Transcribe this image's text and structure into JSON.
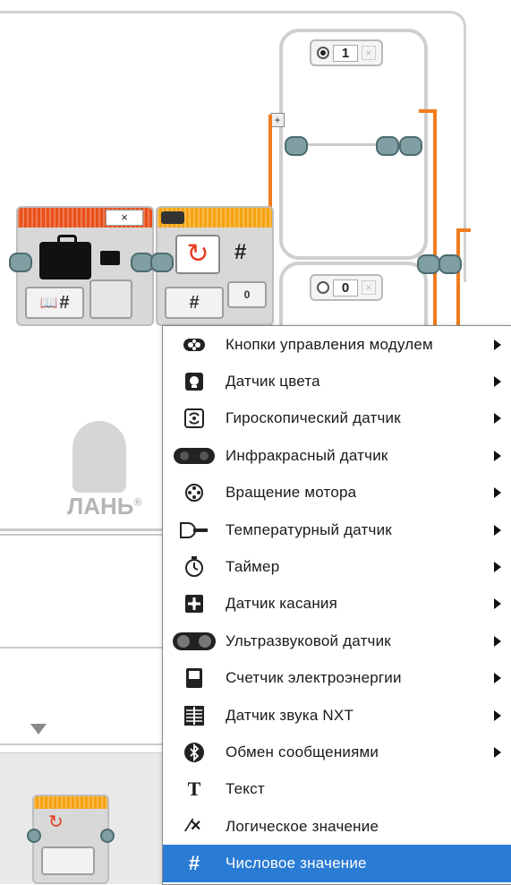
{
  "canvas": {
    "case_top_value": "1",
    "case_bottom_value": "0",
    "case_remove_glyph": "×",
    "add_case_glyph": "+",
    "block1_close_glyph": "×",
    "param_hash_label": "#",
    "book_hash_label": "#",
    "switch_output_hash": "#",
    "switch_value": "0"
  },
  "watermark": {
    "text": "ЛАНЬ",
    "mark": "®"
  },
  "menu": {
    "items": [
      {
        "label": "Кнопки управления модулем",
        "icon": "brick-buttons-icon",
        "has_submenu": true
      },
      {
        "label": "Датчик цвета",
        "icon": "color-sensor-icon",
        "has_submenu": true
      },
      {
        "label": "Гироскопический датчик",
        "icon": "gyro-sensor-icon",
        "has_submenu": true
      },
      {
        "label": "Инфракрасный датчик",
        "icon": "infrared-sensor-icon",
        "has_submenu": true
      },
      {
        "label": "Вращение мотора",
        "icon": "motor-rotation-icon",
        "has_submenu": true
      },
      {
        "label": "Температурный датчик",
        "icon": "temperature-sensor-icon",
        "has_submenu": true
      },
      {
        "label": "Таймер",
        "icon": "timer-icon",
        "has_submenu": true
      },
      {
        "label": "Датчик касания",
        "icon": "touch-sensor-icon",
        "has_submenu": true
      },
      {
        "label": "Ультразвуковой датчик",
        "icon": "ultrasonic-sensor-icon",
        "has_submenu": true
      },
      {
        "label": "Счетчик электроэнергии",
        "icon": "energy-meter-icon",
        "has_submenu": true
      },
      {
        "label": "Датчик звука NXT",
        "icon": "nxt-sound-sensor-icon",
        "has_submenu": true
      },
      {
        "label": "Обмен сообщениями",
        "icon": "bluetooth-messaging-icon",
        "has_submenu": true
      },
      {
        "label": "Текст",
        "icon": "text-icon",
        "has_submenu": false
      },
      {
        "label": "Логическое значение",
        "icon": "logic-icon",
        "has_submenu": false
      },
      {
        "label": "Числовое значение",
        "icon": "numeric-icon",
        "has_submenu": false,
        "selected": true
      }
    ],
    "glyphs": {
      "text": "T",
      "logic": "⁄×",
      "numeric": "#"
    }
  },
  "colors": {
    "accent_selected": "#2a7bd4",
    "wire_orange": "#f07c1f",
    "block_head_red": "#e8501a",
    "block_head_orange": "#f5a312",
    "plug": "#7f9fa3"
  }
}
